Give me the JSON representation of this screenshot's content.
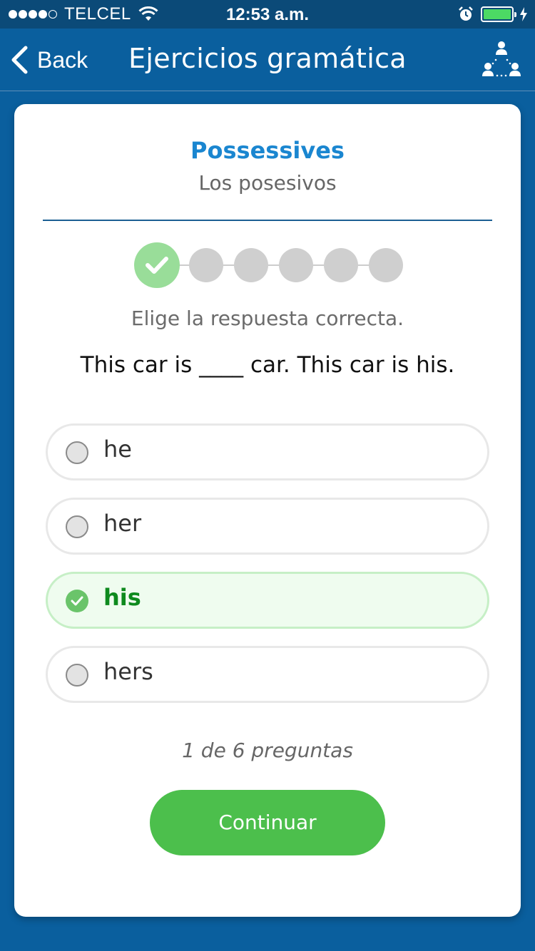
{
  "status_bar": {
    "carrier": "TELCEL",
    "time": "12:53 a.m.",
    "battery_color": "#4cd964"
  },
  "nav": {
    "back_label": "Back",
    "title": "Ejercicios gramática",
    "right_icon": "network-users-icon"
  },
  "lesson": {
    "title": "Possessives",
    "subtitle": "Los posesivos"
  },
  "progress": {
    "completed": 1,
    "total": 6
  },
  "instruction": "Elige la respuesta correcta.",
  "question": "This car is ____ car. This car is his.",
  "options": [
    {
      "label": "he",
      "state": "unselected"
    },
    {
      "label": "her",
      "state": "unselected"
    },
    {
      "label": "his",
      "state": "correct"
    },
    {
      "label": "hers",
      "state": "unselected"
    }
  ],
  "counter": "1 de 6 preguntas",
  "continue_label": "Continuar",
  "colors": {
    "background": "#0a5f9e",
    "accent": "#1a86d0",
    "correct": "#0e8a1e",
    "button": "#4cbf4c"
  }
}
